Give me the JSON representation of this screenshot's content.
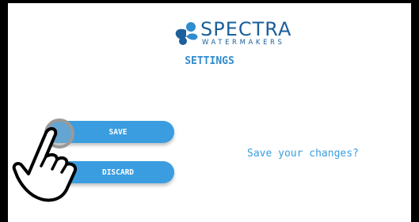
{
  "brand": {
    "name": "SPECTRA",
    "subtitle": "WATERMAKERS",
    "color": "#1b5f9c"
  },
  "header": {
    "title": "SETTINGS"
  },
  "buttons": {
    "save_label": "SAVE",
    "discard_label": "DISCARD"
  },
  "prompt": {
    "text": "Save your changes?"
  },
  "icons": {
    "logo": "spectra-logo-icon",
    "pointer": "hand-pointer-icon",
    "tap": "tap-indicator-icon"
  },
  "colors": {
    "accent": "#3a9de0",
    "title": "#2f8ccf",
    "frame": "#000000",
    "background": "#ffffff"
  }
}
